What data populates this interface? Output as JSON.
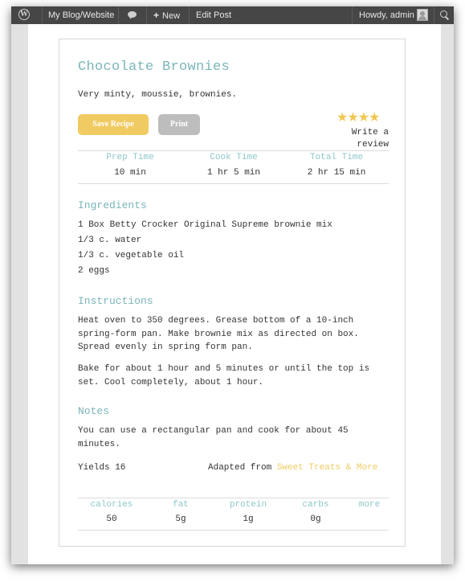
{
  "admin_bar": {
    "site_name": "My Blog/Website",
    "new_label": "New",
    "edit_label": "Edit Post",
    "howdy": "Howdy, admin"
  },
  "recipe": {
    "title": "Chocolate Brownies",
    "summary": "Very minty, moussie, brownies.",
    "save_label": "Save Recipe",
    "print_label": "Print",
    "rating_stars": "★★★★",
    "rating_value": 4,
    "review_line1": "Write a",
    "review_line2": "review",
    "times": [
      {
        "label": "Prep Time",
        "value": "10 min"
      },
      {
        "label": "Cook Time",
        "value": "1 hr 5 min"
      },
      {
        "label": "Total Time",
        "value": "2 hr 15 min"
      }
    ],
    "ingredients_heading": "Ingredients",
    "ingredients": [
      "1 Box Betty Crocker Original Supreme brownie mix",
      "1/3 c. water",
      "1/3 c. vegetable oil",
      "2 eggs"
    ],
    "instructions_heading": "Instructions",
    "instructions": [
      "Heat oven to 350 degrees. Grease bottom of a 10-inch spring-form pan. Make brownie mix as directed on box. Spread evenly in spring form pan.",
      "Bake for about 1 hour and 5 minutes or until the top is set. Cool completely, about 1 hour."
    ],
    "notes_heading": "Notes",
    "notes": "You can use a rectangular pan and cook for about 45 minutes.",
    "yields": "Yields 16",
    "adapted_prefix": "Adapted from",
    "adapted_source": "Sweet Treats & More",
    "nutrition": [
      {
        "label": "calories",
        "value": "50"
      },
      {
        "label": "fat",
        "value": "5g"
      },
      {
        "label": "protein",
        "value": "1g"
      },
      {
        "label": "carbs",
        "value": "0g"
      },
      {
        "label": "more",
        "value": ""
      }
    ]
  },
  "colors": {
    "admin_bar": "#464646",
    "heading": "#7bb5ba",
    "accent_yellow": "#f0cb62",
    "button_gray": "#bdbdbd"
  }
}
